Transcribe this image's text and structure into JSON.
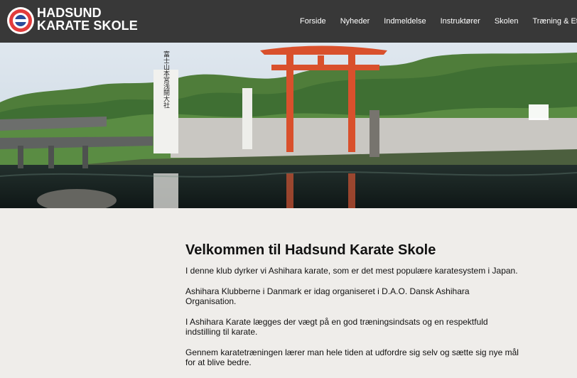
{
  "header": {
    "title_line1": "HADSUND",
    "title_line2": "KARATE SKOLE",
    "nav": [
      {
        "label": "Forside"
      },
      {
        "label": "Nyheder"
      },
      {
        "label": "Indmeldelse"
      },
      {
        "label": "Instruktører"
      },
      {
        "label": "Skolen"
      },
      {
        "label": "Træning & Etiket"
      }
    ]
  },
  "hero": {
    "pillar_text": "富士山本宮浅間大社"
  },
  "content": {
    "title": "Velkommen til Hadsund Karate Skole",
    "paragraphs": [
      "I denne klub dyrker vi Ashihara karate, som er det mest populære karatesystem i Japan.",
      "Ashihara Klubberne i Danmark er idag organiseret i D.A.O. Dansk Ashihara Organisation.",
      "I Ashihara Karate lægges der vægt på en god træningsindsats og en respektfuld indstilling til karate.",
      "Gennem karatetræningen lærer man hele tiden at udfordre sig selv og sætte sig nye mål for at blive bedre."
    ]
  },
  "colors": {
    "header_bg": "#383838",
    "page_bg": "#efedea",
    "torii_red": "#d9502c"
  }
}
